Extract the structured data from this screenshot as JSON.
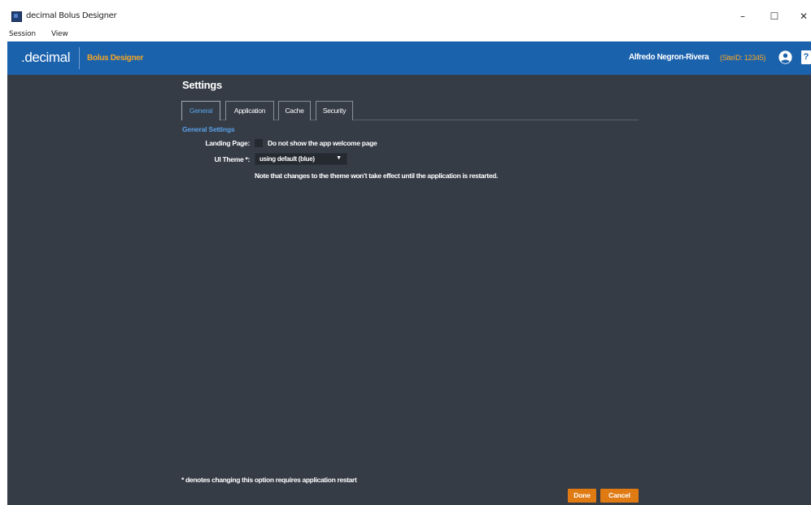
{
  "window": {
    "title": "decimal Bolus Designer",
    "minimize_glyph": "–",
    "maximize_glyph": "☐",
    "close_glyph": "✕",
    "icon": "app-icon"
  },
  "menu": {
    "items": [
      {
        "label": "Session"
      },
      {
        "label": "View"
      }
    ]
  },
  "header": {
    "brand": ".decimal",
    "product": "Bolus Designer",
    "user_name": "Alfredo Negron-Rivera",
    "site_id": "(SiteID: 12345)",
    "user_icon": "user-circle-icon",
    "help_label": "?",
    "colors": {
      "bar": "#1b62ad",
      "accent": "#f5a623"
    }
  },
  "settings": {
    "title": "Settings",
    "tabs": [
      {
        "label": "General",
        "active": true
      },
      {
        "label": "Application",
        "active": false
      },
      {
        "label": "Cache",
        "active": false
      },
      {
        "label": "Security",
        "active": false
      }
    ],
    "section_heading": "General Settings",
    "landing_page": {
      "label": "Landing Page:",
      "checkbox_label": "Do not show the app welcome page",
      "checked": false
    },
    "ui_theme": {
      "label": "UI Theme *:",
      "selected": "using default (blue)",
      "note": "Note that changes to the theme won't take effect until the application is restarted."
    },
    "footnote": "* denotes changing this option requires application restart",
    "buttons": {
      "done": "Done",
      "cancel": "Cancel"
    },
    "colors": {
      "background": "#353c46",
      "tab_active": "#5aa0e6",
      "button": "#e07a12"
    }
  }
}
